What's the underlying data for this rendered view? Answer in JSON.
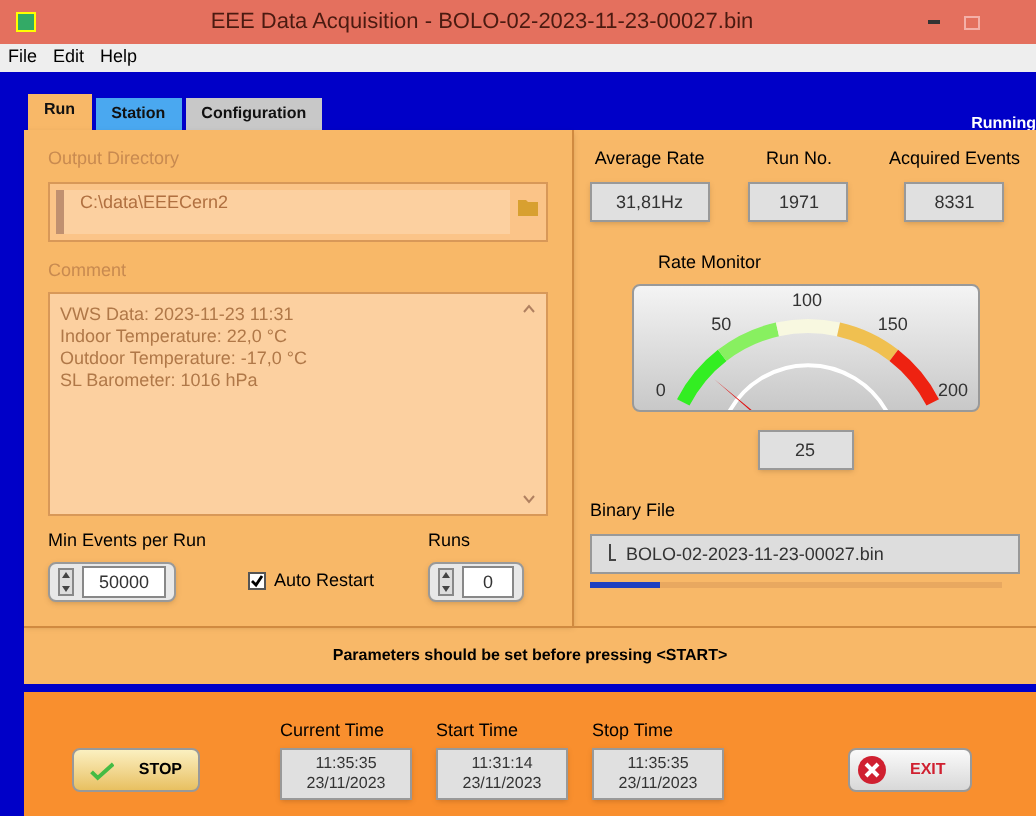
{
  "window": {
    "title": "EEE Data Acquisition - BOLO-02-2023-11-23-00027.bin"
  },
  "menu": [
    "File",
    "Edit",
    "Help"
  ],
  "tabs": [
    {
      "label": "Run",
      "selected": true
    },
    {
      "label": "Station",
      "selected": false
    },
    {
      "label": "Configuration",
      "selected": false
    }
  ],
  "status_indicator": "Running",
  "output_directory": {
    "label": "Output Directory",
    "value": "C:\\data\\EEECern2"
  },
  "comment": {
    "label": "Comment",
    "lines": [
      "VWS Data: 2023-11-23 11:31",
      "Indoor Temperature: 22,0 °C",
      "Outdoor Temperature: -17,0 °C",
      "SL Barometer: 1016 hPa"
    ]
  },
  "min_events": {
    "label": "Min Events per Run",
    "value": "50000"
  },
  "auto_restart": {
    "label": "Auto Restart",
    "checked": true
  },
  "runs": {
    "label": "Runs",
    "value": "0"
  },
  "indicators": [
    {
      "label": "Average Rate",
      "value": "31,81Hz"
    },
    {
      "label": "Run No.",
      "value": "1971"
    },
    {
      "label": "Acquired Events",
      "value": "8331"
    }
  ],
  "rate_monitor": {
    "label": "Rate Monitor",
    "ticks": [
      "0",
      "50",
      "100",
      "150",
      "200"
    ],
    "reading": "25"
  },
  "binary_file": {
    "label": "Binary File",
    "value": "BOLO-02-2023-11-23-00027.bin",
    "level": 0.17
  },
  "status_message": "Parameters should be set before pressing <START>",
  "stop_button": "STOP",
  "times": [
    {
      "label": "Current Time",
      "time": "11:35:35",
      "date": "23/11/2023"
    },
    {
      "label": "Start Time",
      "time": "11:31:14",
      "date": "23/11/2023"
    },
    {
      "label": "Stop Time",
      "time": "11:35:35",
      "date": "23/11/2023"
    }
  ],
  "exit_button": "EXIT"
}
